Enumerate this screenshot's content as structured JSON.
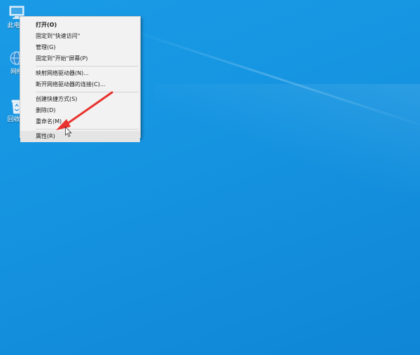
{
  "desktop": {
    "icons": [
      {
        "name": "this-pc",
        "label": "此电脑"
      },
      {
        "name": "network",
        "label": "网络"
      },
      {
        "name": "recycle-bin",
        "label": "回收站"
      }
    ]
  },
  "context_menu": {
    "items": [
      {
        "label": "打开(O)",
        "bold": true
      },
      {
        "label": "固定到\"快速访问\""
      },
      {
        "label": "管理(G)"
      },
      {
        "label": "固定到\"开始\"屏幕(P)"
      },
      {
        "separator": true
      },
      {
        "label": "映射网络驱动器(N)..."
      },
      {
        "label": "断开网络驱动器的连接(C)..."
      },
      {
        "separator": true
      },
      {
        "label": "创建快捷方式(S)"
      },
      {
        "label": "删除(D)"
      },
      {
        "label": "重命名(M)"
      },
      {
        "separator": true
      },
      {
        "label": "属性(R)",
        "hover": true
      }
    ]
  },
  "annotation": {
    "arrow_color": "#e8322d"
  }
}
